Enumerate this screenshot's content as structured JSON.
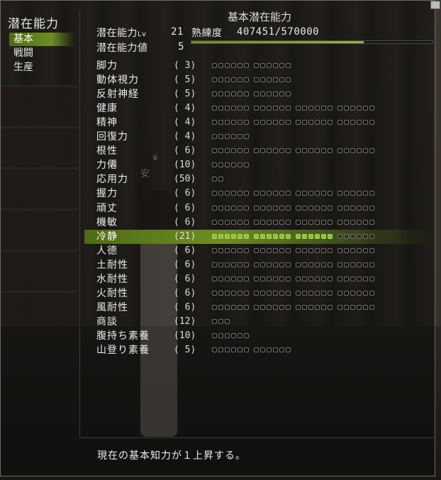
{
  "window": {
    "title": "潜在能力"
  },
  "sidebar": {
    "items": [
      {
        "label": "基本",
        "active": true
      },
      {
        "label": "戦闘",
        "active": false
      },
      {
        "label": "生産",
        "active": false
      }
    ]
  },
  "panel": {
    "title": "基本潜在能力",
    "level_label": "潜在能力",
    "level_unit": "Lv",
    "level_value": "21",
    "proficiency_label": "熟練度",
    "proficiency_value": "407451/570000",
    "proficiency_fraction": 0.715,
    "points_label": "潜在能力値",
    "points_value": "5"
  },
  "scene": {
    "character_name": "安",
    "crown_glyph": "♛"
  },
  "stats": [
    {
      "name": "脚力",
      "level": "( 3)",
      "pips": 12,
      "filled": 0
    },
    {
      "name": "動体視力",
      "level": "( 5)",
      "pips": 12,
      "filled": 0
    },
    {
      "name": "反射神経",
      "level": "( 5)",
      "pips": 12,
      "filled": 0
    },
    {
      "name": "健康",
      "level": "( 4)",
      "pips": 24,
      "filled": 0
    },
    {
      "name": "精神",
      "level": "( 4)",
      "pips": 24,
      "filled": 0
    },
    {
      "name": "回復力",
      "level": "( 4)",
      "pips": 6,
      "filled": 0
    },
    {
      "name": "根性",
      "level": "( 6)",
      "pips": 24,
      "filled": 0
    },
    {
      "name": "力僊",
      "level": "(10)",
      "pips": 6,
      "filled": 0
    },
    {
      "name": "応用力",
      "level": "(50)",
      "pips": 2,
      "filled": 0
    },
    {
      "name": "握力",
      "level": "( 6)",
      "pips": 24,
      "filled": 0
    },
    {
      "name": "頑丈",
      "level": "( 6)",
      "pips": 24,
      "filled": 0
    },
    {
      "name": "機敏",
      "level": "( 6)",
      "pips": 24,
      "filled": 0
    },
    {
      "name": "冷静",
      "level": "(21)",
      "pips": 24,
      "filled": 18,
      "active": true
    },
    {
      "name": "人德",
      "level": "( 6)",
      "pips": 24,
      "filled": 0
    },
    {
      "name": "土耐性",
      "level": "( 6)",
      "pips": 24,
      "filled": 0
    },
    {
      "name": "水耐性",
      "level": "( 6)",
      "pips": 24,
      "filled": 0
    },
    {
      "name": "火耐性",
      "level": "( 6)",
      "pips": 24,
      "filled": 0
    },
    {
      "name": "風耐性",
      "level": "( 6)",
      "pips": 24,
      "filled": 0
    },
    {
      "name": "商談",
      "level": "(12)",
      "pips": 3,
      "filled": 0
    },
    {
      "name": "腹持ち素養",
      "level": "(10)",
      "pips": 6,
      "filled": 0
    },
    {
      "name": "山登り素養",
      "level": "( 5)",
      "pips": 12,
      "filled": 0
    }
  ],
  "description": "現在の基本知力が１上昇する。",
  "colors": {
    "accent_green": "#6e8e23",
    "pip_filled": "#8bc23a"
  }
}
